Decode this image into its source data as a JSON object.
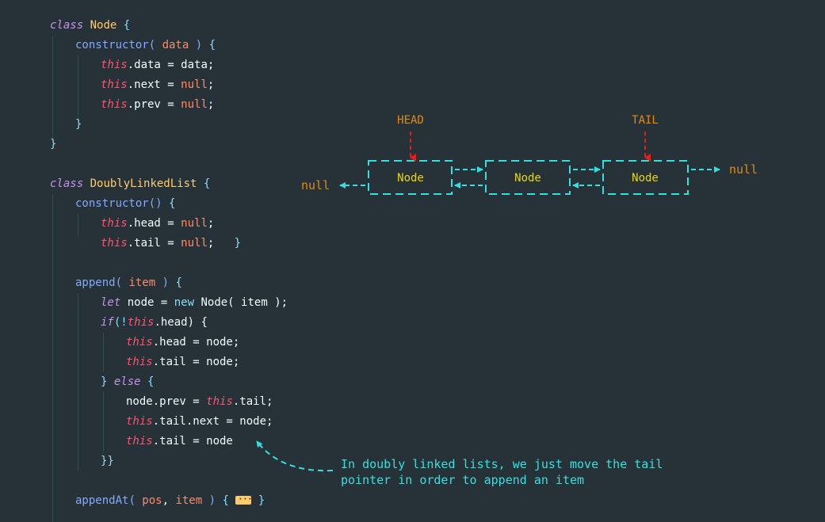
{
  "code": {
    "class_kw": "class",
    "node_class": "Node",
    "constructor": "constructor",
    "data_param": "data",
    "this_kw": "this",
    "data_prop": ".data = ",
    "data_val": "data",
    "next_prop": ".next = ",
    "prev_prop": ".prev = ",
    "null_kw": "null",
    "list_class": "DoublyLinkedList",
    "head_prop": ".head = ",
    "tail_prop": ".tail = ",
    "append_fn": "append",
    "item_param": "item",
    "let_kw": "let",
    "node_var": " node = ",
    "new_kw": "new",
    "node_call": " Node( ",
    "item_arg": "item",
    "if_kw": "if",
    "head_check": ".head) {",
    "head_assign": ".head = node;",
    "tail_assign": ".tail = node;",
    "else_kw": "else",
    "node_prev": "node.prev = ",
    "tail_end": ".tail;",
    "tail_next": ".tail.next = node;",
    "tail_node": ".tail = node",
    "close_braces": "}}",
    "append_at_fn": "appendAt",
    "pos_param": "pos",
    "item_param2": "item"
  },
  "diagram": {
    "head_label": "HEAD",
    "tail_label": "TAIL",
    "nodes": [
      "Node",
      "Node",
      "Node"
    ],
    "null_left": "null",
    "null_right": "null"
  },
  "annotation": {
    "line1": "In doubly linked lists, we just move the tail",
    "line2": "pointer in order to append an item"
  },
  "colors": {
    "background": "#263238",
    "keyword": "#c792ea",
    "class_name": "#ffcb6b",
    "function": "#82aaff",
    "parameter": "#f78c6c",
    "this": "#ff5370",
    "diagram_line": "#33e0e0",
    "diagram_label": "#e08a0a",
    "pointer_arrow": "#e51c1c",
    "node_text": "#e6d60a"
  }
}
